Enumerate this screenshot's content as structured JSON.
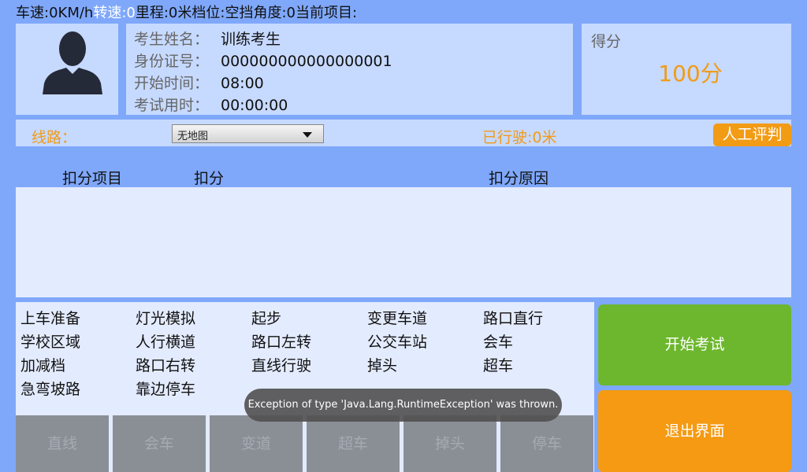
{
  "status": {
    "speed": "车速:0KM/h",
    "rpm_label": "转速:",
    "rpm_value": "0",
    "mileage": "里程:0米",
    "gear": "档位:空挡",
    "angle": "角度:0",
    "current_item": "当前项目:"
  },
  "student": {
    "name_label": "考生姓名：",
    "name_value": "训练考生",
    "id_label": "身份证号：",
    "id_value": "000000000000000001",
    "start_label": "开始时间：",
    "start_value": "08:00",
    "elapsed_label": "考试用时：",
    "elapsed_value": "00:00:00"
  },
  "score": {
    "label": "得分",
    "value": "100分"
  },
  "route": {
    "label": "线路：",
    "selected": "无地图",
    "distance": "已行驶:0米",
    "manual_button": "人工评判"
  },
  "deduction_table": {
    "headers": [
      "扣分项目",
      "扣分",
      "扣分原因"
    ]
  },
  "exam_items": [
    [
      "上车准备",
      "灯光模拟",
      "起步",
      "变更车道",
      "路口直行"
    ],
    [
      "学校区域",
      "人行横道",
      "路口左转",
      "公交车站",
      "会车"
    ],
    [
      "加减档",
      "路口右转",
      "直线行驶",
      "掉头",
      "超车"
    ],
    [
      "急弯坡路",
      "靠边停车"
    ]
  ],
  "quick_buttons": [
    "直线",
    "会车",
    "变道",
    "超车",
    "掉头",
    "停车"
  ],
  "actions": {
    "start": "开始考试",
    "exit": "退出界面"
  },
  "toast": "Exception of type 'Java.Lang.RuntimeException' was thrown.",
  "colors": {
    "background": "#7fa8fb",
    "panel": "#c6d9ff",
    "accent_orange": "#f29b15",
    "start_green": "#6cb72d",
    "quick_disabled": "#8a8f96"
  },
  "icons": {
    "avatar": "person-silhouette-icon",
    "dropdown": "triangle-down-icon"
  }
}
